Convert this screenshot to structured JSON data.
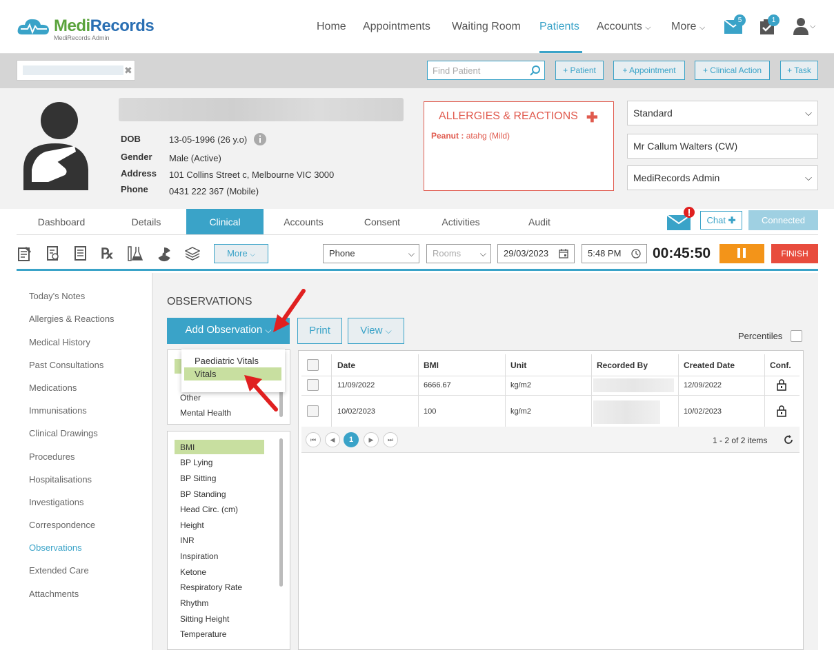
{
  "brand": {
    "name_part1": "Medi",
    "name_part2": "Records",
    "subtitle": "MediRecords Admin"
  },
  "nav": {
    "items": [
      "Home",
      "Appointments",
      "Waiting Room",
      "Patients",
      "Accounts",
      "More"
    ],
    "active": "Patients",
    "mail_badge": "5",
    "tasks_badge": "1"
  },
  "search": {
    "find_placeholder": "Find Patient",
    "buttons": [
      "+ Patient",
      "+ Appointment",
      "+ Clinical Action",
      "+ Task"
    ]
  },
  "patient": {
    "labels": {
      "dob": "DOB",
      "gender": "Gender",
      "address": "Address",
      "phone": "Phone"
    },
    "dob": "13-05-1996 (26 y.o)",
    "gender": "Male (Active)",
    "address": "101 Collins Street c, Melbourne VIC 3000",
    "phone": "0431 222 367 (Mobile)"
  },
  "allergies": {
    "title": "ALLERGIES & REACTIONS",
    "item_name": "Peanut :",
    "item_detail": "atahg (Mild)"
  },
  "right_panel": {
    "billing": "Standard",
    "practitioner": "Mr Callum Walters (CW)",
    "location": "MediRecords Admin"
  },
  "tabs": [
    "Dashboard",
    "Details",
    "Clinical",
    "Accounts",
    "Consent",
    "Activities",
    "Audit"
  ],
  "tabs_active": "Clinical",
  "chat": {
    "label": "Chat",
    "connected": "Connected"
  },
  "toolbar": {
    "more": "More",
    "consult_type": "Phone",
    "rooms_placeholder": "Rooms",
    "date": "29/03/2023",
    "time": "5:48 PM",
    "timer": "00:45:50",
    "finish": "FINISH"
  },
  "sidebar": {
    "items": [
      "Today's Notes",
      "Allergies & Reactions",
      "Medical History",
      "Past Consultations",
      "Medications",
      "Immunisations",
      "Clinical Drawings",
      "Procedures",
      "Hospitalisations",
      "Investigations",
      "Correspondence",
      "Observations",
      "Extended Care",
      "Attachments"
    ],
    "active": "Observations"
  },
  "observations": {
    "title": "OBSERVATIONS",
    "add_button": "Add Observation",
    "print_button": "Print",
    "view_button": "View",
    "percentiles_label": "Percentiles",
    "dropdown_items": [
      "Paediatric Vitals",
      "Vitals"
    ],
    "dropdown_highlight": "Vitals",
    "group_list": [
      "Other",
      "Mental Health"
    ],
    "type_list": [
      "BMI",
      "BP Lying",
      "BP Sitting",
      "BP Standing",
      "Head Circ. (cm)",
      "Height",
      "INR",
      "Inspiration",
      "Ketone",
      "Respiratory Rate",
      "Rhythm",
      "Sitting Height",
      "Temperature"
    ],
    "type_selected": "BMI",
    "grid": {
      "headers": [
        "Date",
        "BMI",
        "Unit",
        "Recorded By",
        "Created Date",
        "Conf."
      ],
      "rows": [
        {
          "date": "11/09/2022",
          "bmi": "6666.67",
          "unit": "kg/m2",
          "created": "12/09/2022"
        },
        {
          "date": "10/02/2023",
          "bmi": "100",
          "unit": "kg/m2",
          "created": "10/02/2023"
        }
      ],
      "page": "1",
      "summary": "1 - 2 of 2 items"
    }
  },
  "colors": {
    "accent": "#3aa3c8",
    "danger": "#e05a4e",
    "pause": "#f39419",
    "finish": "#e84c3d",
    "highlight": "#c8dfa0"
  }
}
